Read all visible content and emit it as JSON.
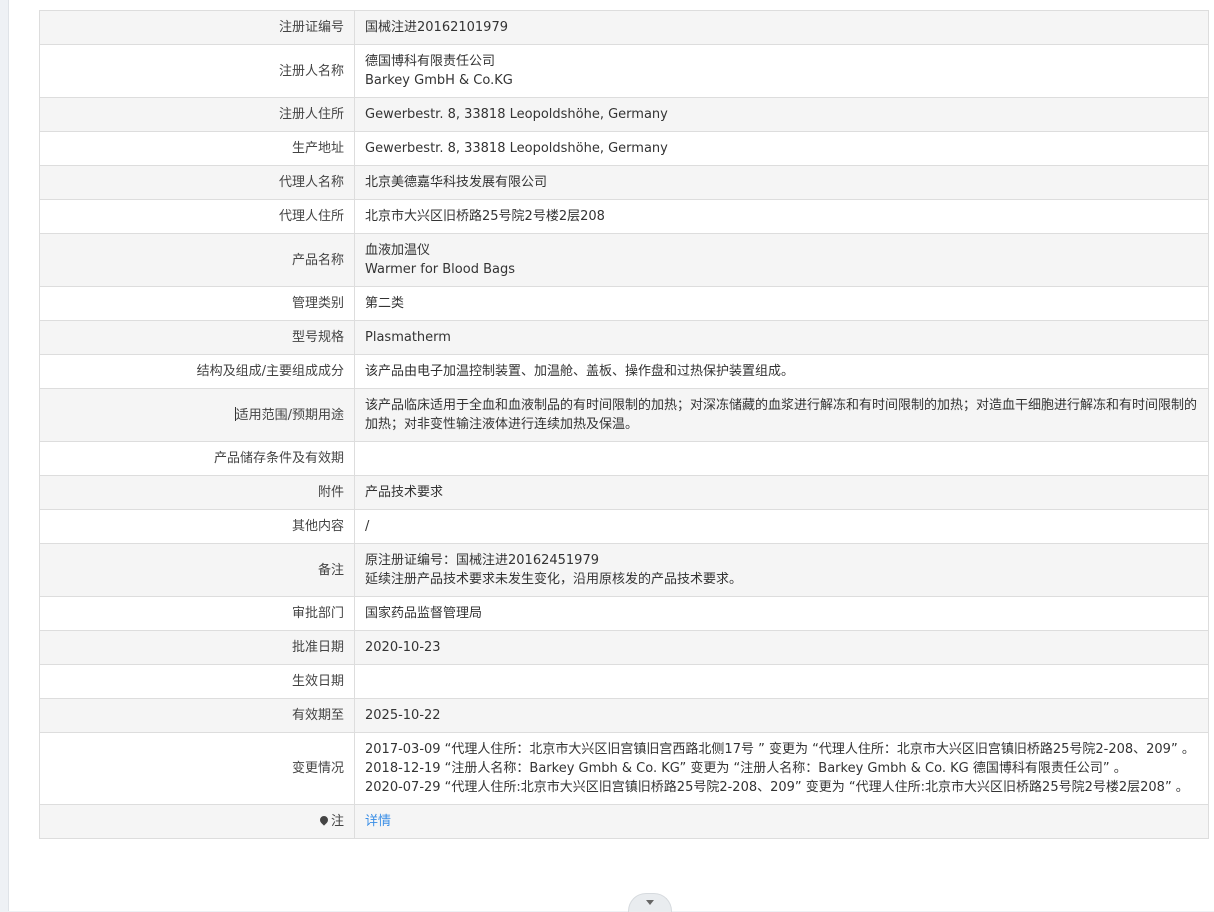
{
  "rows": [
    {
      "label": "注册证编号",
      "value": "国械注进20162101979"
    },
    {
      "label": "注册人名称",
      "value": "德国博科有限责任公司\nBarkey GmbH & Co.KG"
    },
    {
      "label": "注册人住所",
      "value": "Gewerbestr. 8, 33818 Leopoldshöhe, Germany"
    },
    {
      "label": "生产地址",
      "value": "Gewerbestr. 8, 33818 Leopoldshöhe, Germany"
    },
    {
      "label": "代理人名称",
      "value": "北京美德嘉华科技发展有限公司"
    },
    {
      "label": "代理人住所",
      "value": "北京市大兴区旧桥路25号院2号楼2层208"
    },
    {
      "label": "产品名称",
      "value": "血液加温仪\nWarmer for Blood Bags"
    },
    {
      "label": "管理类别",
      "value": "第二类"
    },
    {
      "label": "型号规格",
      "value": "Plasmatherm"
    },
    {
      "label": "结构及组成/主要组成成分",
      "value": "该产品由电子加温控制装置、加温舱、盖板、操作盘和过热保护装置组成。"
    },
    {
      "label": "适用范围/预期用途",
      "value": "该产品临床适用于全血和血液制品的有时间限制的加热；对深冻储藏的血浆进行解冻和有时间限制的加热；对造血干细胞进行解冻和有时间限制的加热；对非变性输注液体进行连续加热及保温。"
    },
    {
      "label": "产品储存条件及有效期",
      "value": ""
    },
    {
      "label": "附件",
      "value": "产品技术要求"
    },
    {
      "label": "其他内容",
      "value": "/"
    },
    {
      "label": "备注",
      "value": "原注册证编号：国械注进20162451979\n延续注册产品技术要求未发生变化，沿用原核发的产品技术要求。"
    },
    {
      "label": "审批部门",
      "value": "国家药品监督管理局"
    },
    {
      "label": "批准日期",
      "value": "2020-10-23"
    },
    {
      "label": "生效日期",
      "value": ""
    },
    {
      "label": "有效期至",
      "value": "2025-10-22"
    },
    {
      "label": "变更情况",
      "value": "2017-03-09 “代理人住所：北京市大兴区旧宫镇旧宫西路北侧17号 ” 变更为 “代理人住所：北京市大兴区旧宫镇旧桥路25号院2-208、209” 。\n2018-12-19 “注册人名称：Barkey Gmbh & Co. KG” 变更为 “注册人名称：Barkey Gmbh & Co. KG 德国博科有限责任公司” 。\n2020-07-29 “代理人住所:北京市大兴区旧宫镇旧桥路25号院2-208、209” 变更为 “代理人住所:北京市大兴区旧桥路25号院2号楼2层208” 。"
    }
  ],
  "last_row": {
    "label": "注",
    "link_text": "详情",
    "label_icon": "map-pin-icon"
  },
  "collapse_icon": "chevron-down-icon"
}
